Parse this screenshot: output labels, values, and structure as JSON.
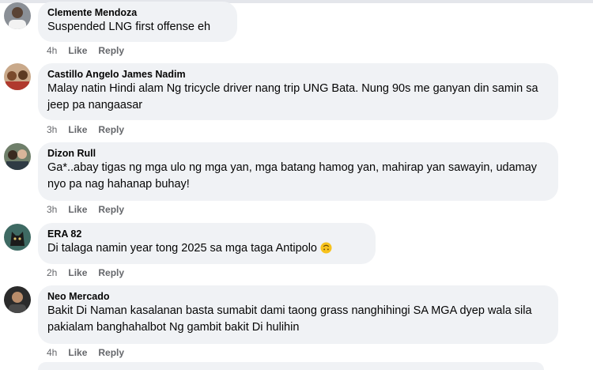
{
  "comments": [
    {
      "author": "Clemente Mendoza",
      "text": "Suspended LNG first offense eh",
      "time": "4h",
      "like": "Like",
      "reply": "Reply",
      "avatar": "man-white-shirt"
    },
    {
      "author": "Castillo Angelo James Nadim",
      "text": "Malay natin Hindi alam Ng tricycle driver nang trip UNG Bata. Nung 90s me ganyan din samin sa jeep pa nangaasar",
      "time": "3h",
      "like": "Like",
      "reply": "Reply",
      "avatar": "group-photo"
    },
    {
      "author": "Dizon Rull",
      "text": "Ga*..abay tigas ng mga ulo ng mga yan, mga batang hamog yan, mahirap yan sawayin, udamay nyo pa nag hahanap buhay!",
      "time": "3h",
      "like": "Like",
      "reply": "Reply",
      "avatar": "couple-photo"
    },
    {
      "author": "ERA 82",
      "text": "Di talaga namin year tong 2025 sa mga taga Antipolo",
      "time": "2h",
      "like": "Like",
      "reply": "Reply",
      "avatar": "dark-cat",
      "emoji": "upside-down-face-emoji"
    },
    {
      "author": "Neo Mercado",
      "text": "Bakit Di Naman kasalanan basta sumabit dami taong grass nanghihingi SA MGA dyep wala sila pakialam banghahalbot Ng gambit bakit Di hulihin",
      "time": "4h",
      "like": "Like",
      "reply": "Reply",
      "avatar": "man-dark-photo"
    }
  ]
}
